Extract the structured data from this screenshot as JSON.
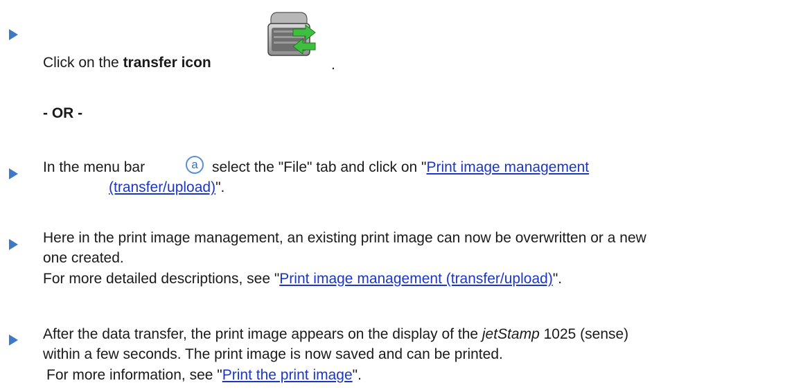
{
  "step1": {
    "prefix": "Click on the ",
    "bold": "transfer icon",
    "suffix": "."
  },
  "or_separator": "- OR -",
  "step2": {
    "prefix": "In the menu bar",
    "marker": "a",
    "middle": "select the \"File\" tab and click on \"",
    "link_part1": "Print image management",
    "link_part2": "(transfer/upload)",
    "suffix": "\"."
  },
  "step3": {
    "line1": "Here in the print image management, an existing print image can now be overwritten or a new",
    "line2": "one created.",
    "line3_prefix": "For more detailed descriptions, see \"",
    "line3_link": "Print image management (transfer/upload)",
    "line3_suffix": "\"."
  },
  "step4": {
    "line1_prefix": "After the data transfer, the print image appears on the display of the ",
    "line1_italic": "jetStamp",
    "line1_suffix": " 1025 (sense)",
    "line2": "within a few seconds. The print image is now saved and can be printed.",
    "line3_prefix": "For more information, see \"",
    "line3_link": "Print the print image",
    "line3_suffix": "\"."
  },
  "colors": {
    "arrow": "#3d79c4",
    "link": "#1a36c9",
    "icon_green": "#3fbf3f"
  },
  "icons": {
    "bullet": "triangle-right",
    "transfer": "printer-transfer-icon",
    "marker": "circled-letter-a"
  }
}
